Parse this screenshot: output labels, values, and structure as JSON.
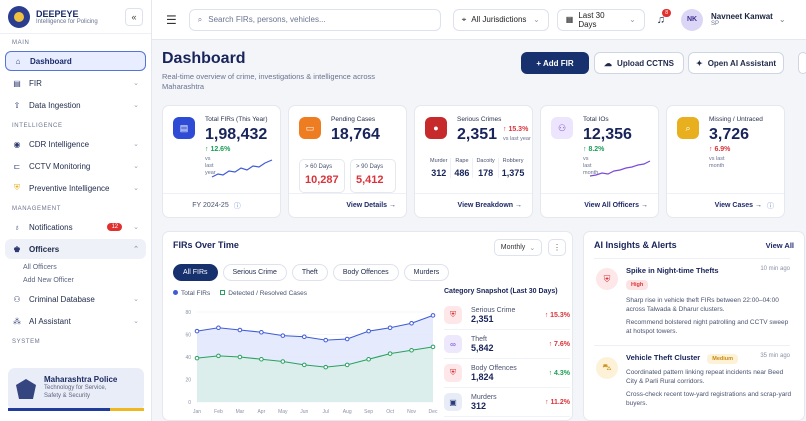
{
  "brand": {
    "name": "DEEPEYE",
    "tagline": "Intelligence for Policing",
    "collapse": "«"
  },
  "sidebar": {
    "sections": {
      "main": "MAIN",
      "intelligence": "INTELLIGENCE",
      "management": "MANAGEMENT",
      "system": "SYSTEM"
    },
    "items": {
      "dashboard": "Dashboard",
      "fir": "FIR",
      "ingestion": "Data Ingestion",
      "cdr": "CDR Intelligence",
      "cctv": "CCTV Monitoring",
      "preventive": "Preventive Intelligence",
      "notifications": "Notifications",
      "notifications_badge": "12",
      "officers": "Officers",
      "all_officers": "All Officers",
      "add_officer": "Add New Officer",
      "criminal_db": "Criminal Database",
      "ai_assistant": "AI Assistant"
    },
    "police": {
      "title": "Maharashtra Police",
      "line1": "Technology for Service,",
      "line2": "Safety & Security"
    }
  },
  "topbar": {
    "search_placeholder": "Search FIRs, persons, vehicles...",
    "jurisdiction": "All Jurisdictions",
    "date_range": "Last 30 Days",
    "bell_count": "8",
    "user": {
      "initials": "NK",
      "name": "Navneet Kanwat",
      "role": "SP"
    }
  },
  "page": {
    "title": "Dashboard",
    "subtitle": "Real-time overview of crime, investigations & intelligence across Maharashtra",
    "add_fir": "+ Add FIR",
    "upload_cctns": "Upload CCTNS",
    "open_ai": "Open AI Assistant"
  },
  "cards": {
    "total_firs": {
      "title": "Total FIRs (This Year)",
      "value": "1,98,432",
      "delta": "↑ 12.6%",
      "note": "vs last year",
      "footer": "FY 2024-25",
      "color": "#2d4bd4"
    },
    "pending": {
      "title": "Pending Cases",
      "value": "18,764",
      "b1_label": "> 60 Days",
      "b1_value": "10,287",
      "b2_label": "> 90 Days",
      "b2_value": "5,412",
      "footer": "View Details →",
      "color": "#ee7d22"
    },
    "serious": {
      "title": "Serious Crimes",
      "value": "2,351",
      "delta": "↑ 15.3%",
      "note": "vs last year",
      "footer": "View Breakdown →",
      "color": "#c62a2a",
      "breakdown": [
        {
          "label": "Murder",
          "value": "312"
        },
        {
          "label": "Rape",
          "value": "486"
        },
        {
          "label": "Dacoity",
          "value": "178"
        },
        {
          "label": "Robbery",
          "value": "1,375"
        }
      ]
    },
    "ios": {
      "title": "Total IOs",
      "value": "12,356",
      "delta": "↑ 8.2%",
      "note": "vs last month",
      "footer": "View All Officers →",
      "color": "#7a4bd8"
    },
    "missing": {
      "title": "Missing / Untraced",
      "value": "3,726",
      "delta": "↑ 6.9%",
      "note": "vs last month",
      "footer": "View Cases →",
      "color": "#e8b01e"
    }
  },
  "firs_panel": {
    "title": "FIRs Over Time",
    "period": "Monthly",
    "tabs": [
      "All FIRs",
      "Serious Crime",
      "Theft",
      "Body Offences",
      "Murders"
    ],
    "legend": {
      "total": "Total FIRs",
      "detected": "Detected / Resolved Cases"
    }
  },
  "chart_data": {
    "type": "area",
    "categories": [
      "Jan",
      "Feb",
      "Mar",
      "Apr",
      "May",
      "Jun",
      "Jul",
      "Aug",
      "Sep",
      "Oct",
      "Nov",
      "Dec"
    ],
    "series": [
      {
        "name": "Total FIRs",
        "color": "#3f5bd6",
        "values": [
          63,
          66,
          64,
          62,
          59,
          58,
          55,
          56,
          63,
          66,
          70,
          77
        ]
      },
      {
        "name": "Detected / Resolved Cases",
        "color": "#2aa160",
        "values": [
          39,
          41,
          40,
          38,
          36,
          33,
          31,
          33,
          38,
          43,
          46,
          49
        ]
      }
    ],
    "yticks": [
      "0",
      "20",
      "40",
      "60",
      "80"
    ],
    "ylim": [
      0,
      80
    ]
  },
  "snapshot": {
    "title": "Category Snapshot (Last 30 Days)",
    "rows": [
      {
        "name": "Serious Crime",
        "value": "2,351",
        "pct": "↑ 15.3%",
        "pct_color": "#d9343a",
        "icon": "shield-icon",
        "bg": "#fde7e8",
        "fg": "#d9343a",
        "glyph": "⛨"
      },
      {
        "name": "Theft",
        "value": "5,842",
        "pct": "↑ 7.6%",
        "pct_color": "#d9343a",
        "icon": "handcuffs-icon",
        "bg": "#ede8fc",
        "fg": "#6b47d4",
        "glyph": "∞"
      },
      {
        "name": "Body Offences",
        "value": "1,824",
        "pct": "↑ 4.3%",
        "pct_color": "#1b9d55",
        "icon": "shield-alert-icon",
        "bg": "#fde7e8",
        "fg": "#d9343a",
        "glyph": "⛨"
      },
      {
        "name": "Murders",
        "value": "312",
        "pct": "↑ 11.2%",
        "pct_color": "#d9343a",
        "icon": "document-icon",
        "bg": "#e8ecf7",
        "fg": "#2a3b7c",
        "glyph": "▣"
      }
    ]
  },
  "insights": {
    "title": "AI Insights & Alerts",
    "view_all": "View All",
    "items": [
      {
        "title": "Spike in Night-time Thefts",
        "time": "10 min ago",
        "tag": "High",
        "tag_bg": "#fde2e3",
        "tag_fg": "#d9343a",
        "text1": "Sharp rise in vehicle theft FIRs between 22:00–04:00 across Talwada & Dharur clusters.",
        "text2": "Recommend bolstered night patrolling and CCTV sweep at hotspot towers."
      },
      {
        "title": "Vehicle Theft Cluster",
        "time": "35 min ago",
        "tag": "Medium",
        "tag_bg": "#fdf1d8",
        "tag_fg": "#c98a0e",
        "text1": "Coordinated pattern linking repeat incidents near Beed City & Parli Rural corridors.",
        "text2": "Cross-check recent tow-yard registrations and scrap-yard buyers."
      }
    ]
  }
}
